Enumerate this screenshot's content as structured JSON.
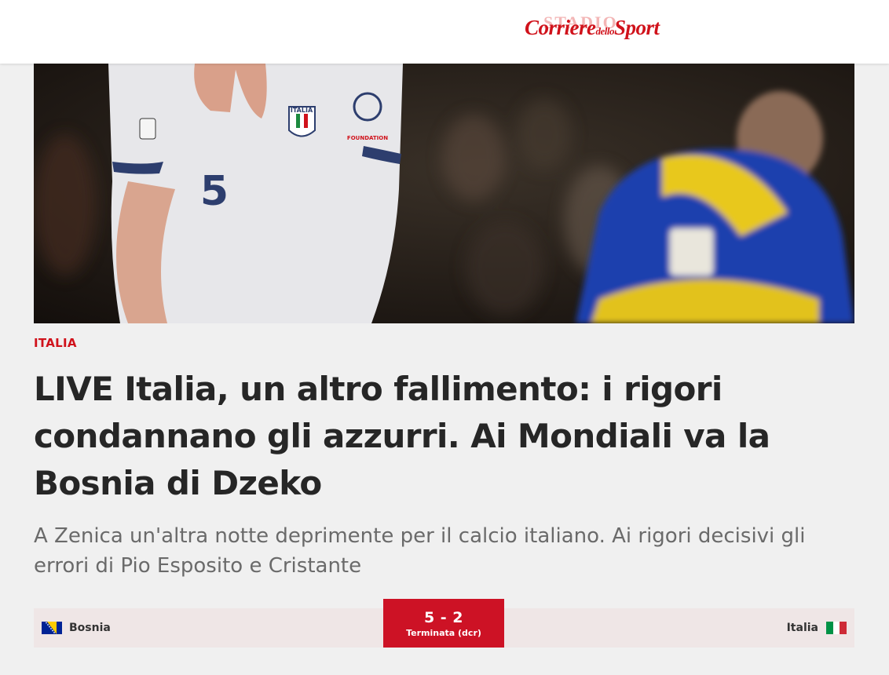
{
  "header": {
    "logo_text": "Corriere dello Sport",
    "logo_main_left": "Corriere",
    "logo_small": "dello",
    "logo_main_right": "Sport",
    "logo_ghost": "STADIO"
  },
  "article": {
    "category": "ITALIA",
    "headline": "LIVE Italia, un altro fallimento: i rigori condannano gli azzurri. Ai Mondiali va la Bosnia di Dzeko",
    "subheadline": "A Zenica un'altra notte deprimente per il calcio italiano. Ai rigori decisivi gli errori di Pio Esposito e Cristante",
    "hero_image": {
      "jersey_text": "ITALIA",
      "shirt_number": "5",
      "badge_text": "FOUNDATION"
    }
  },
  "match": {
    "home_team": "Bosnia",
    "away_team": "Italia",
    "score": "5 - 2",
    "status": "Terminata (dcr)"
  },
  "colors": {
    "brand_red": "#d0121b",
    "score_red": "#cd1225",
    "scorebar_bg": "#efe6e6",
    "page_bg": "#f0f0f0"
  }
}
